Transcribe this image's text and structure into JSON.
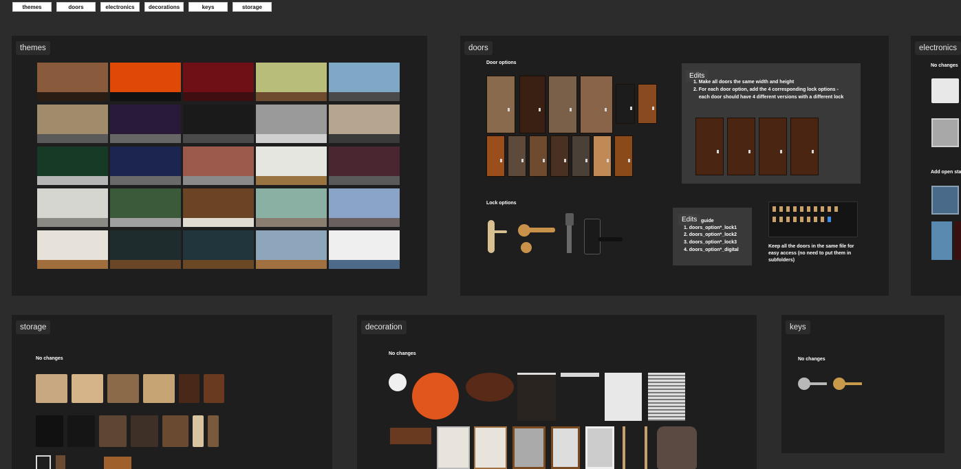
{
  "nav": [
    "themes",
    "doors",
    "electronics",
    "decorations",
    "keys",
    "storage"
  ],
  "frames": {
    "themes": {
      "title": "themes"
    },
    "doors": {
      "title": "doors",
      "door_options_label": "Door options",
      "lock_options_label": "Lock options",
      "edits1": {
        "label": "Edits",
        "lines": [
          "1. Make all doors the same width and height",
          "2. For each door option, add the 4 corresponding lock options -",
          "    each door should have 4 different versions with a different lock"
        ]
      },
      "edits2": {
        "label": "Edits",
        "lines": [
          "guide",
          "1. doors_option*_lock1",
          "2. doors_option*_lock2",
          "3. doors_option*_lock3",
          "4. doors_option*_digital"
        ]
      },
      "file_note": [
        "Keep all the doors in the same file for",
        "easy access (no need to put them in",
        "subfolders)"
      ]
    },
    "electronics": {
      "title": "electronics",
      "no_changes": "No changes",
      "add_open": "Add open sta"
    },
    "storage": {
      "title": "storage",
      "no_changes": "No changes"
    },
    "decoration": {
      "title": "decoration",
      "no_changes": "No changes"
    },
    "keys": {
      "title": "keys",
      "no_changes": "No changes"
    }
  },
  "theme_tiles": [
    {
      "wall": "#8a5a3c",
      "floor": "#2a1d14"
    },
    {
      "wall": "#e04806",
      "floor": "#111111"
    },
    {
      "wall": "#6e1016",
      "floor": "#3e0e10"
    },
    {
      "wall": "#b8be7a",
      "floor": "#6e4a2e"
    },
    {
      "wall": "#7fa8c6",
      "floor": "#4a4a4a"
    },
    {
      "wall": "#a08c6a",
      "floor": "#5a5a5a"
    },
    {
      "wall": "#2a1a3a",
      "floor": "#666666"
    },
    {
      "wall": "#1a1a1a",
      "floor": "#4a4a4a"
    },
    {
      "wall": "#9a9a9a",
      "floor": "#cfcfcf"
    },
    {
      "wall": "#b6a690",
      "floor": "#3a3a3a"
    },
    {
      "wall": "#173a26",
      "floor": "#b6b6b6"
    },
    {
      "wall": "#1c2450",
      "floor": "#6a6a6a"
    },
    {
      "wall": "#9c5a4c",
      "floor": "#8a8a8a"
    },
    {
      "wall": "#e6e6e0",
      "floor": "#9a7440"
    },
    {
      "wall": "#4a2630",
      "floor": "#5a5a5a"
    },
    {
      "wall": "#d6d6d0",
      "floor": "#8a8a84"
    },
    {
      "wall": "#3a5a3a",
      "floor": "#a0a0a0"
    },
    {
      "wall": "#6a4424",
      "floor": "#e0dcd2"
    },
    {
      "wall": "#8ab0a4",
      "floor": "#8a7e70"
    },
    {
      "wall": "#8aa4c8",
      "floor": "#6a6060"
    },
    {
      "wall": "#e6e2da",
      "floor": "#a06e3c"
    },
    {
      "wall": "#1e2c2e",
      "floor": "#6a4626"
    },
    {
      "wall": "#21363c",
      "floor": "#6a4826"
    },
    {
      "wall": "#8ea6bc",
      "floor": "#a07040"
    },
    {
      "wall": "#efefef",
      "floor": "#4e6a8a"
    }
  ],
  "door_row1": [
    "#8a6a4c",
    "#3a2012",
    "#7a6048",
    "#8a6448",
    "#1c1c1c",
    "#8a4a20"
  ],
  "door_row2": [
    "#9a4e1c",
    "#5e4a3a",
    "#6e4a2e",
    "#4a3020",
    "#4a4038",
    "#c08a56",
    "#8a4a1a"
  ],
  "edit_doors": [
    "#4a2612",
    "#4a2612",
    "#4a2612",
    "#4a2612"
  ],
  "folder_icons": [
    "#c9a06a",
    "#c9a06a",
    "#c9a06a",
    "#c9a06a",
    "#c9a06a",
    "#c9a06a",
    "#c9a06a",
    "#c9a06a",
    "#c9a06a",
    "#c9a06a",
    "#c9a06a",
    "#c9a06a",
    "#c9a06a",
    "#c9a06a",
    "#c9a06a",
    "#c9a06a",
    "#c9a06a",
    "#c9a06a",
    "#3a8ee6"
  ],
  "storage_items": [
    {
      "c": "#c8a880",
      "w": 46
    },
    {
      "c": "#d6b48a",
      "w": 46
    },
    {
      "c": "#8a6a48",
      "w": 46
    },
    {
      "c": "#c6a474",
      "w": 46
    },
    {
      "c": "#4a2818",
      "w": 30
    },
    {
      "c": "#6a3a20",
      "w": 30
    },
    {
      "c": "#111111",
      "w": 40
    },
    {
      "c": "#151515",
      "w": 40
    },
    {
      "c": "#5e4634",
      "w": 40
    },
    {
      "c": "#3e3026",
      "w": 40
    },
    {
      "c": "#6a4a30",
      "w": 38
    },
    {
      "c": "#d8c4a0",
      "w": 16
    },
    {
      "c": "#7a5a3c",
      "w": 16
    }
  ]
}
